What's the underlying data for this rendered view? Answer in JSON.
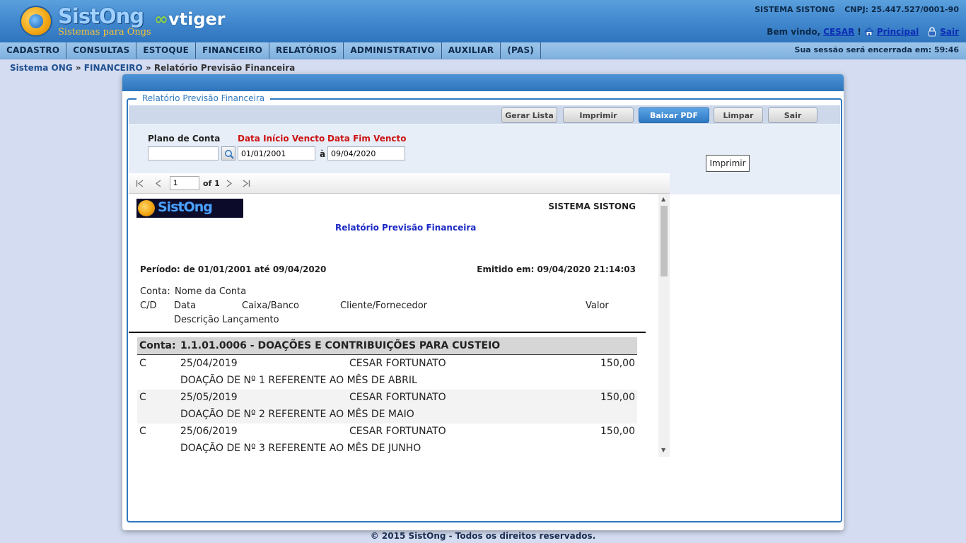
{
  "header": {
    "logo_name": "SistOng",
    "logo_tagline": "Sistemas para Ongs",
    "partner_logo": "vtiger",
    "system_name": "SISTEMA SISTONG",
    "cnpj": "CNPJ: 25.447.527/0001-90",
    "welcome_prefix": "Bem vindo,",
    "username": "CESAR",
    "welcome_suffix": "!",
    "home_link": "Principal",
    "logout_link": "Sair",
    "home_icon": "house-icon",
    "logout_icon": "lock-icon"
  },
  "menu": {
    "items": [
      "CADASTRO",
      "CONSULTAS",
      "ESTOQUE",
      "FINANCEIRO",
      "RELATÓRIOS",
      "ADMINISTRATIVO",
      "AUXILIAR",
      "(PAS)"
    ],
    "session_label": "Sua sessão será encerrada em:",
    "session_time": "59:46"
  },
  "breadcrumb": {
    "root": "Sistema ONG",
    "section": "FINANCEIRO",
    "separator": "»",
    "current": "Relatório Previsão Financeira"
  },
  "form": {
    "legend": "Relatório Previsão Financeira",
    "buttons": {
      "gerar_lista": "Gerar Lista",
      "imprimir": "Imprimir",
      "baixar_pdf": "Baixar PDF",
      "limpar": "Limpar",
      "sair": "Sair"
    },
    "plano_conta_label": "Plano de Conta",
    "plano_conta_value": "",
    "data_inicio_label": "Data Início Vencto",
    "data_inicio_value": "01/01/2001",
    "to_label": "à",
    "data_fim_label": "Data Fim Vencto",
    "data_fim_value": "09/04/2020",
    "tooltip": "Imprimir",
    "colors": {
      "required_label": "#cc1111",
      "accent": "#2f79bf"
    }
  },
  "viewer": {
    "page_value": "1",
    "page_of": "of 1",
    "icons": [
      "first-page-icon",
      "prev-page-icon",
      "next-page-icon",
      "last-page-icon"
    ]
  },
  "report": {
    "logo_text": "SistOng",
    "system_name": "SISTEMA SISTONG",
    "title": "Relatório Previsão Financeira",
    "period": "Período: de 01/01/2001 até 09/04/2020",
    "emitted": "Emitido em: 09/04/2020 21:14:03",
    "headers": {
      "conta": "Conta:",
      "nome_conta": "Nome da Conta",
      "cd": "C/D",
      "data": "Data",
      "caixa_banco": "Caixa/Banco",
      "cliente_fornecedor": "Cliente/Fornecedor",
      "valor": "Valor",
      "descricao": "Descrição Lançamento"
    },
    "group": {
      "label": "Conta:",
      "account": "1.1.01.0006 - DOAÇÕES E CONTRIBUIÇÕES PARA CUSTEIO"
    },
    "entries": [
      {
        "cd": "C",
        "date": "25/04/2019",
        "client": "CESAR FORTUNATO",
        "value": "150,00",
        "description": "DOAÇÃO DE Nº 1 REFERENTE AO MÊS DE ABRIL"
      },
      {
        "cd": "C",
        "date": "25/05/2019",
        "client": "CESAR FORTUNATO",
        "value": "150,00",
        "description": "DOAÇÃO DE Nº 2 REFERENTE AO MÊS DE MAIO"
      },
      {
        "cd": "C",
        "date": "25/06/2019",
        "client": "CESAR FORTUNATO",
        "value": "150,00",
        "description": "DOAÇÃO DE Nº 3 REFERENTE AO MÊS DE JUNHO"
      }
    ]
  },
  "footer": {
    "text": "© 2015 SistOng - Todos os direitos reservados."
  }
}
